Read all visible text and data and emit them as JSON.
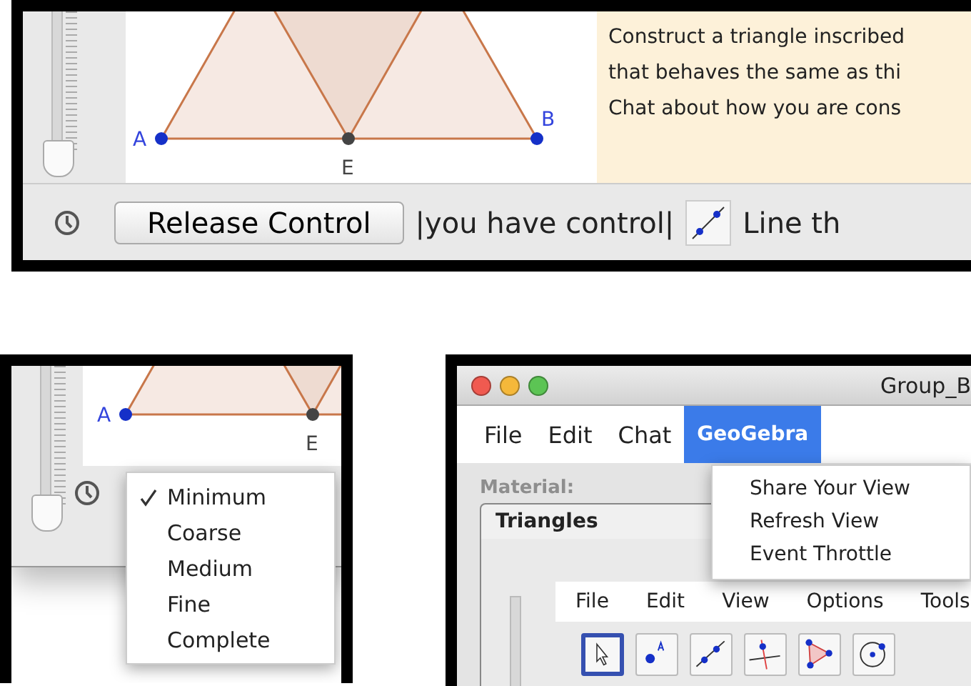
{
  "shared_view": {
    "points": [
      {
        "label": "A"
      },
      {
        "label": "E"
      },
      {
        "label": "B"
      }
    ],
    "instructions": [
      "Construct a triangle inscribed",
      "that behaves the same as thi",
      "Chat about how you are cons"
    ],
    "release_button": "Release Control",
    "control_status": "|you have control|",
    "current_tool": "Line th"
  },
  "throttle_menu": {
    "points": [
      {
        "label": "A"
      },
      {
        "label": "E"
      }
    ],
    "items": [
      {
        "label": "Minimum",
        "selected": true
      },
      {
        "label": "Coarse",
        "selected": false
      },
      {
        "label": "Medium",
        "selected": false
      },
      {
        "label": "Fine",
        "selected": false
      },
      {
        "label": "Complete",
        "selected": false
      }
    ]
  },
  "app_window": {
    "title": "Group_B",
    "menus": [
      {
        "label": "File",
        "selected": false
      },
      {
        "label": "Edit",
        "selected": false
      },
      {
        "label": "Chat",
        "selected": false
      },
      {
        "label": "GeoGebra",
        "selected": true
      }
    ],
    "dropdown": [
      "Share Your View",
      "Refresh View",
      "Event Throttle"
    ],
    "material_label": "Material:",
    "tab": "Triangles",
    "geogebra_menus": [
      "File",
      "Edit",
      "View",
      "Options",
      "Tools"
    ],
    "tools": [
      {
        "kind": "pointer",
        "selected": true
      },
      {
        "kind": "point",
        "selected": false
      },
      {
        "kind": "line",
        "selected": false
      },
      {
        "kind": "perpendicular",
        "selected": false
      },
      {
        "kind": "polygon",
        "selected": false
      },
      {
        "kind": "circle",
        "selected": false
      }
    ]
  }
}
